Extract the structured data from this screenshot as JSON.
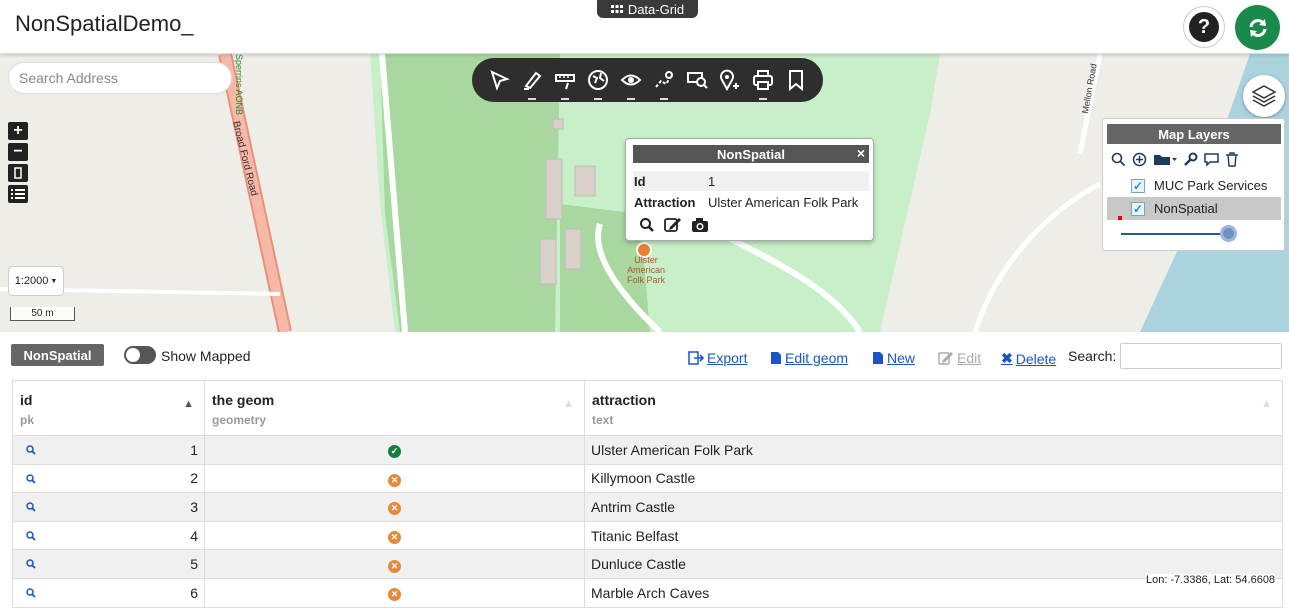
{
  "header": {
    "app_title": "NonSpatialDemo_",
    "grid_tab_label": "Data-Grid",
    "help_label": "?"
  },
  "map": {
    "search_placeholder": "Search Address",
    "zoom_in": "+",
    "zoom_out": "−",
    "scale_select": "1:2000",
    "scale_bar": "50 m",
    "road_labels": {
      "broad_ford": "Broad Ford Road",
      "sperrins": "Sperrins AONB",
      "mellon": "Mellon Road"
    },
    "marker_label": "Ulster American Folk Park",
    "toolbar_icons": [
      "select-icon",
      "draw-icon",
      "measure-icon",
      "globe-icon",
      "eye-icon",
      "route-icon",
      "search-feature-icon",
      "location-icon",
      "print-icon",
      "bookmark-icon"
    ]
  },
  "popup": {
    "title": "NonSpatial",
    "close": "×",
    "rows": [
      {
        "key": "Id",
        "value": "1"
      },
      {
        "key": "Attraction",
        "value": "Ulster American Folk Park"
      }
    ]
  },
  "layers": {
    "title": "Map Layers",
    "items": [
      {
        "label": "MUC Park Services",
        "checked": true,
        "selected": false
      },
      {
        "label": "NonSpatial",
        "checked": true,
        "selected": true
      }
    ],
    "opacity": 0.95
  },
  "grid": {
    "layer_tag": "NonSpatial",
    "show_mapped_label": "Show Mapped",
    "show_mapped_on": true,
    "actions": {
      "export": "Export",
      "edit_geom": "Edit geom",
      "new": "New",
      "edit": "Edit",
      "delete": "Delete"
    },
    "search_label": "Search:",
    "columns": [
      {
        "name": "id",
        "type": "pk"
      },
      {
        "name": "the geom",
        "type": "geometry"
      },
      {
        "name": "attraction",
        "type": "text"
      }
    ],
    "rows": [
      {
        "id": "1",
        "mapped": true,
        "attraction": "Ulster American Folk Park"
      },
      {
        "id": "2",
        "mapped": false,
        "attraction": "Killymoon Castle"
      },
      {
        "id": "3",
        "mapped": false,
        "attraction": "Antrim Castle"
      },
      {
        "id": "4",
        "mapped": false,
        "attraction": "Titanic Belfast"
      },
      {
        "id": "5",
        "mapped": false,
        "attraction": "Dunluce Castle"
      },
      {
        "id": "6",
        "mapped": false,
        "attraction": "Marble Arch Caves"
      }
    ],
    "coordinates": "Lon: -7.3386, Lat: 54.6608"
  },
  "colors": {
    "accent_green": "#1a8a4a",
    "link_blue": "#1a55c8",
    "mapped_ok": "#15803d",
    "unmapped": "#e38a3e"
  }
}
